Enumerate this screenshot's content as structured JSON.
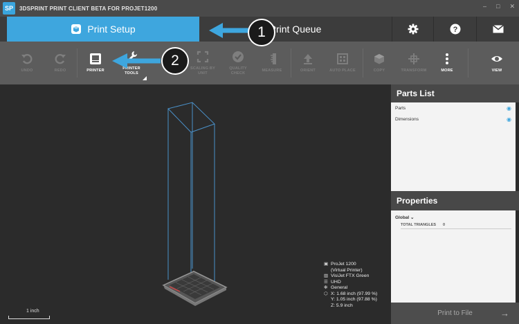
{
  "window": {
    "logo_text": "SP",
    "title": "3DSPRINT PRINT CLIENT BETA FOR PROJET1200",
    "minimize": "–",
    "maximize": "□",
    "close": "✕"
  },
  "tabs": {
    "setup": "Print Setup",
    "queue": "Print Queue"
  },
  "top_icons": [
    "gear-icon",
    "help-icon",
    "mail-icon"
  ],
  "toolbar": {
    "undo": "UNDO",
    "redo": "REDO",
    "printer": "PRINTER",
    "printer_tools_1": "PRINTER",
    "printer_tools_2": "TOOLS",
    "scaling_1": "SCALING BY",
    "scaling_2": "UNIT",
    "quality_1": "QUALITY",
    "quality_2": "CHECK",
    "measure": "MEASURE",
    "orient": "ORIENT",
    "auto_place": "AUTO PLACE",
    "copy": "COPY",
    "transform": "TRANSFORM",
    "more": "MORE",
    "view": "VIEW"
  },
  "viewport": {
    "scale_label": "1 inch",
    "info": {
      "printer": "ProJet 1200",
      "printer_sub": "(Virtual Printer)",
      "material": "VisiJet FTX Green",
      "mode": "UHD",
      "style": "General",
      "x": "X: 1.68 inch (97.99 %)",
      "y": "Y: 1.05 inch (97.88 %)",
      "z": "Z: 5.9 inch"
    }
  },
  "parts_list": {
    "title": "Parts List",
    "items": [
      "Parts",
      "Dimensions"
    ]
  },
  "properties": {
    "title": "Properties",
    "global_label": "Global",
    "triangles_label": "TOTAL TRIANGLES",
    "triangles_value": "0"
  },
  "print_button": "Print to File",
  "callouts": [
    "1",
    "2"
  ],
  "colors": {
    "accent": "#3ea6de",
    "toolbar_bg": "#5c5c5c",
    "viewport_bg": "#2b2b2b"
  }
}
